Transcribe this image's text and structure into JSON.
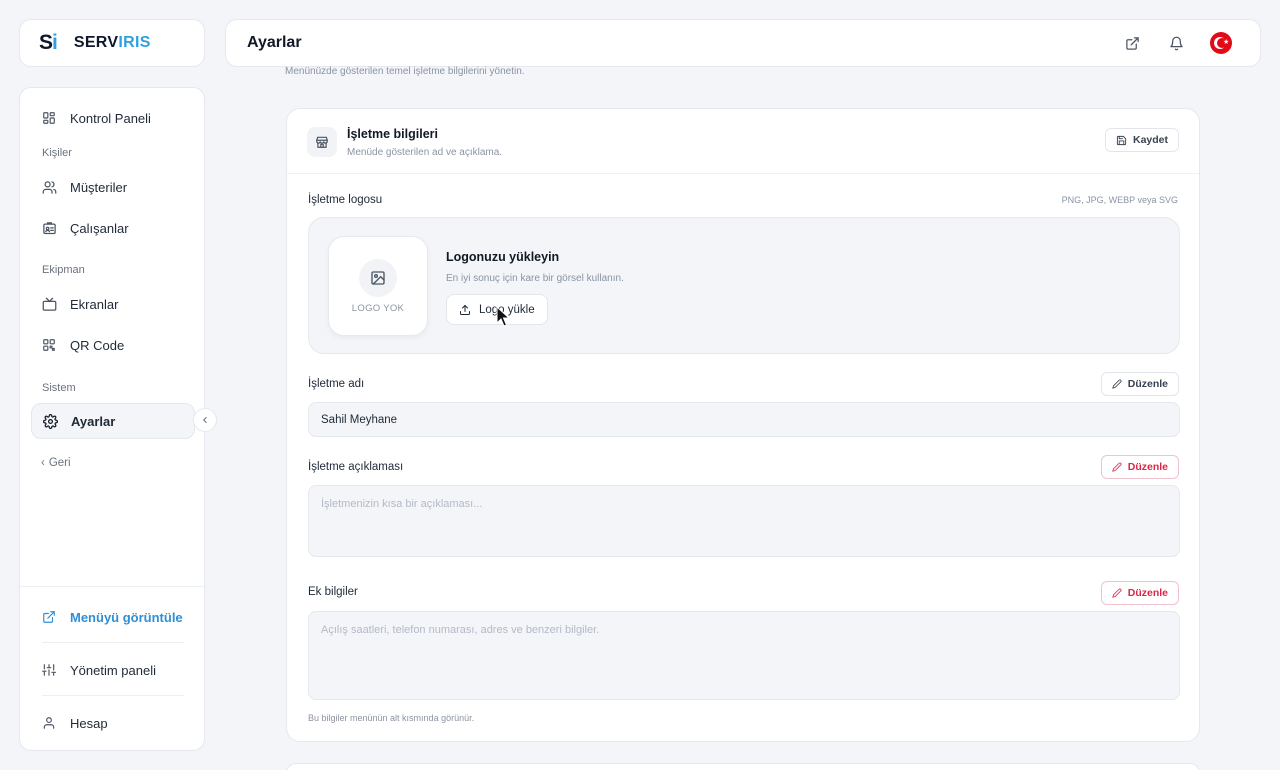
{
  "brand": {
    "mark_s": "S",
    "mark_i": "i",
    "name_part1": "SERV",
    "name_part2": "IRIS",
    "accent_color": "#2ea0e0"
  },
  "header": {
    "title": "Ayarlar",
    "icons": [
      "external-link-icon",
      "bell-icon",
      "turkish-flag-icon"
    ]
  },
  "sidebar": {
    "items": [
      {
        "label": "Kontrol Paneli",
        "icon": "dashboard-icon"
      },
      {
        "label": "Müşteriler",
        "icon": "users-icon"
      },
      {
        "label": "Çalışanlar",
        "icon": "id-badge-icon"
      },
      {
        "label": "Ekranlar",
        "icon": "tv-icon"
      },
      {
        "label": "QR Code",
        "icon": "qr-icon"
      },
      {
        "label": "Ayarlar",
        "icon": "gear-icon",
        "active": true
      }
    ],
    "sections": {
      "people": "Kişiler",
      "equipment": "Ekipman",
      "system": "Sistem"
    },
    "back_label": "Geri",
    "bottom": [
      {
        "label": "Menüyü görüntüle",
        "icon": "external-link-icon",
        "color": "#2e8fd6"
      },
      {
        "label": "Yönetim paneli",
        "icon": "sliders-icon"
      },
      {
        "label": "Hesap",
        "icon": "user-icon"
      }
    ]
  },
  "main": {
    "subtitle": "Menünüzde gösterilen temel işletme bilgilerini yönetin.",
    "card": {
      "title": "İşletme bilgileri",
      "subtitle": "Menüde gösterilen ad ve açıklama.",
      "save_label": "Kaydet",
      "logo": {
        "label": "İşletme logosu",
        "formats": "PNG, JPG, WEBP veya SVG",
        "placeholder": "LOGO YOK",
        "upload_title": "Logonuzu yükleyin",
        "upload_hint": "En iyi sonuç için kare bir görsel kullanın.",
        "upload_button": "Logo yükle"
      },
      "name": {
        "label": "İşletme adı",
        "edit_label": "Düzenle",
        "value": "Sahil Meyhane"
      },
      "description": {
        "label": "İşletme açıklaması",
        "edit_label": "Düzenle",
        "placeholder": "İşletmenizin kısa bir açıklaması..."
      },
      "extra": {
        "label": "Ek bilgiler",
        "edit_label": "Düzenle",
        "placeholder": "Açılış saatleri, telefon numarası, adres ve benzeri bilgiler.",
        "note": "Bu bilgiler menünün alt kısmında görünür."
      }
    }
  },
  "colors": {
    "danger": "#dc2648",
    "background": "#f3f5f8"
  }
}
